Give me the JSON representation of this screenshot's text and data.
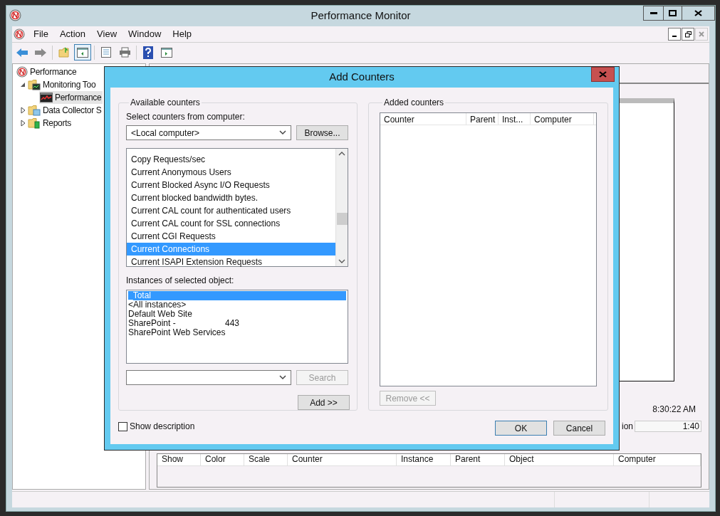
{
  "window": {
    "title": "Performance Monitor"
  },
  "menu": [
    "File",
    "Action",
    "View",
    "Window",
    "Help"
  ],
  "tree": [
    {
      "label": "Performance",
      "kind": "root",
      "selected": false,
      "children": [
        {
          "label": "Monitoring Too",
          "kind": "tools",
          "expanded": true,
          "selected": false,
          "children": [
            {
              "label": "Performance",
              "kind": "monitor",
              "selected": true
            }
          ]
        },
        {
          "label": "Data Collector S",
          "kind": "collector",
          "expanded": false,
          "selected": false
        },
        {
          "label": "Reports",
          "kind": "reports",
          "expanded": false,
          "selected": false
        }
      ]
    }
  ],
  "graph": {
    "time": "8:30:22 AM",
    "duration_label": "ion",
    "duration": "1:40"
  },
  "legend": {
    "columns": [
      "Show",
      "Color",
      "Scale",
      "Counter",
      "Instance",
      "Parent",
      "Object",
      "Computer"
    ]
  },
  "dialog": {
    "title": "Add Counters",
    "available": {
      "label": "Available counters",
      "computer_label": "Select counters from computer:",
      "computer": "<Local computer>",
      "browse": "Browse...",
      "counters": [
        {
          "label": "Copy Requests/sec",
          "selected": false
        },
        {
          "label": "Current Anonymous Users",
          "selected": false
        },
        {
          "label": "Current Blocked Async I/O Requests",
          "selected": false
        },
        {
          "label": "Current blocked bandwidth bytes.",
          "selected": false
        },
        {
          "label": "Current CAL count for authenticated users",
          "selected": false
        },
        {
          "label": "Current CAL count for SSL connections",
          "selected": false
        },
        {
          "label": "Current CGI Requests",
          "selected": false
        },
        {
          "label": "Current Connections",
          "selected": true
        },
        {
          "label": "Current ISAPI Extension Requests",
          "selected": false
        }
      ],
      "instances_label": "Instances of selected object:",
      "instances": [
        {
          "label": "_Total",
          "selected": true
        },
        {
          "label": "<All instances>",
          "selected": false
        },
        {
          "label": "Default Web Site",
          "selected": false
        },
        {
          "label": "SharePoint -",
          "detail": "443",
          "selected": false
        },
        {
          "label": "SharePoint Web Services",
          "selected": false
        }
      ],
      "search": {
        "label": "Search",
        "disabled": true
      },
      "add": "Add >>"
    },
    "added": {
      "label": "Added counters",
      "columns": [
        "Counter",
        "Parent",
        "Inst...",
        "Computer"
      ],
      "remove": {
        "label": "Remove <<",
        "disabled": true
      }
    },
    "show_description": {
      "label": "Show description",
      "checked": false
    },
    "ok": "OK",
    "cancel": "Cancel"
  }
}
